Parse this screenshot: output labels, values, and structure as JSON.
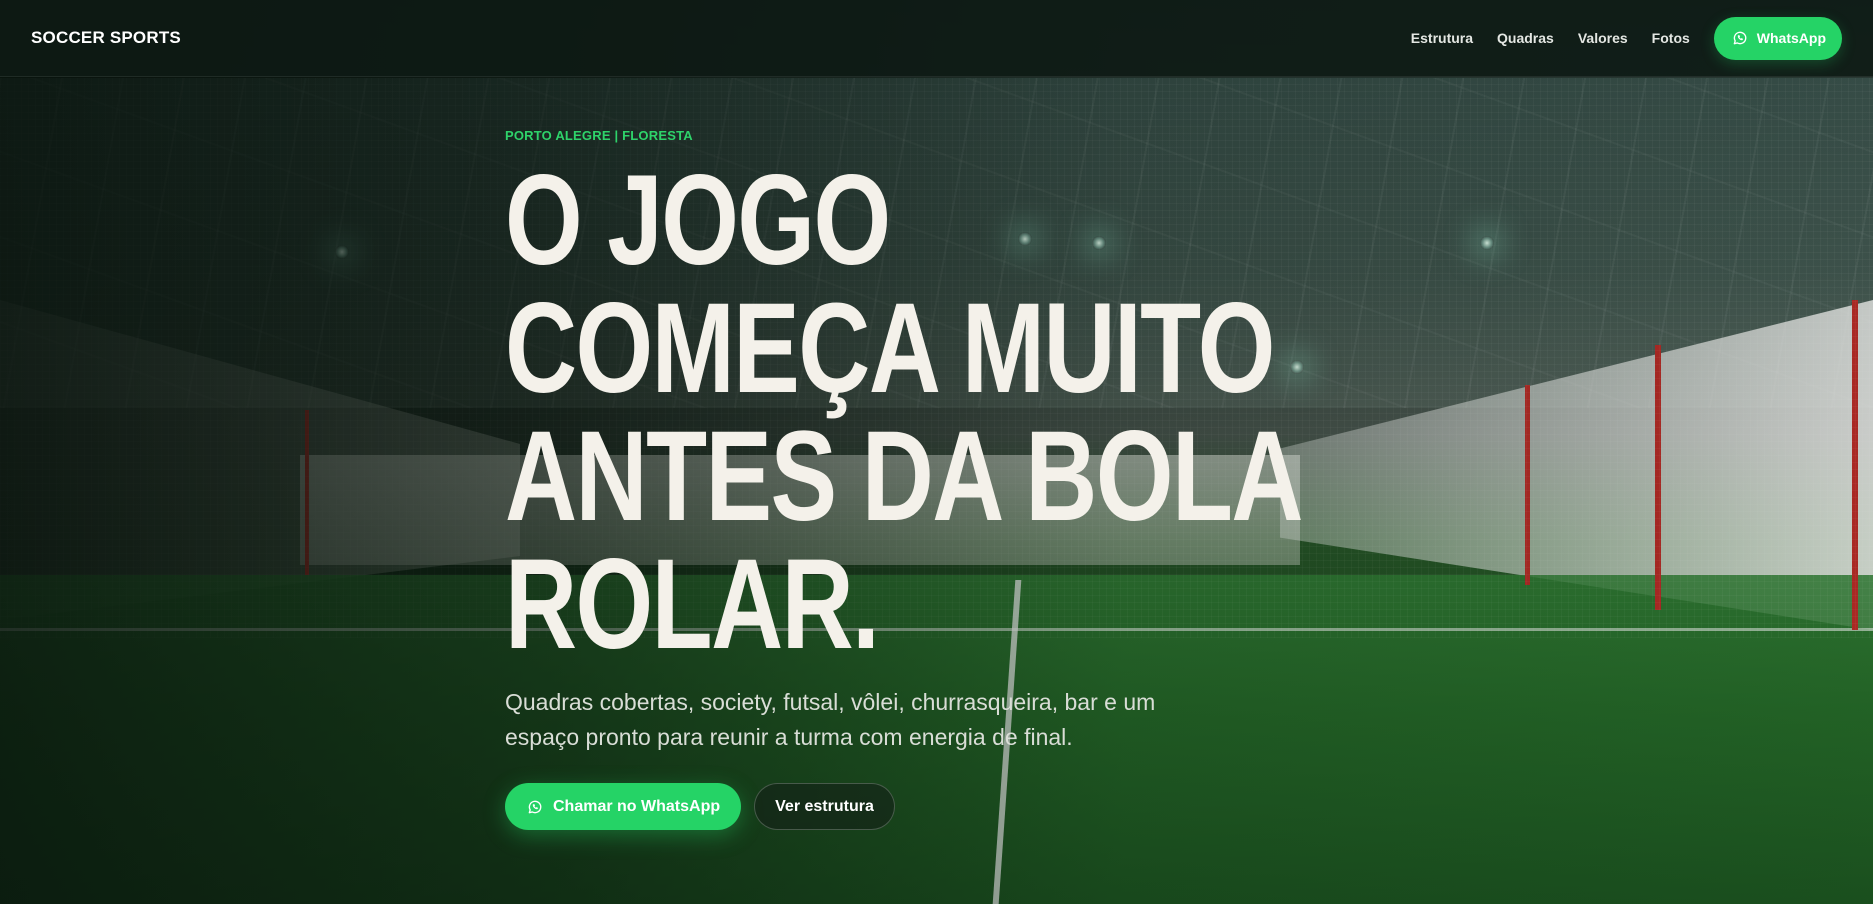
{
  "nav": {
    "brand": "SOCCER SPORTS",
    "links": [
      "Estrutura",
      "Quadras",
      "Valores",
      "Fotos"
    ],
    "cta_label": "WhatsApp",
    "cta_icon": "whatsapp-icon"
  },
  "hero": {
    "location": "PORTO ALEGRE | FLORESTA",
    "headline_lines": [
      "O JOGO",
      "COMEÇA MUITO",
      "ANTES DA BOLA",
      "ROLAR."
    ],
    "subtitle": "Quadras cobertas, society, futsal, vôlei, churrasqueira, bar e um espaço pronto para reunir a turma com energia de final.",
    "primary_button": "Chamar no WhatsApp",
    "primary_icon": "whatsapp-icon",
    "secondary_button": "Ver estrutura"
  },
  "colors": {
    "accent": "#25d366",
    "headline": "#f4f1ea",
    "nav_bg": "#0e1a14"
  }
}
